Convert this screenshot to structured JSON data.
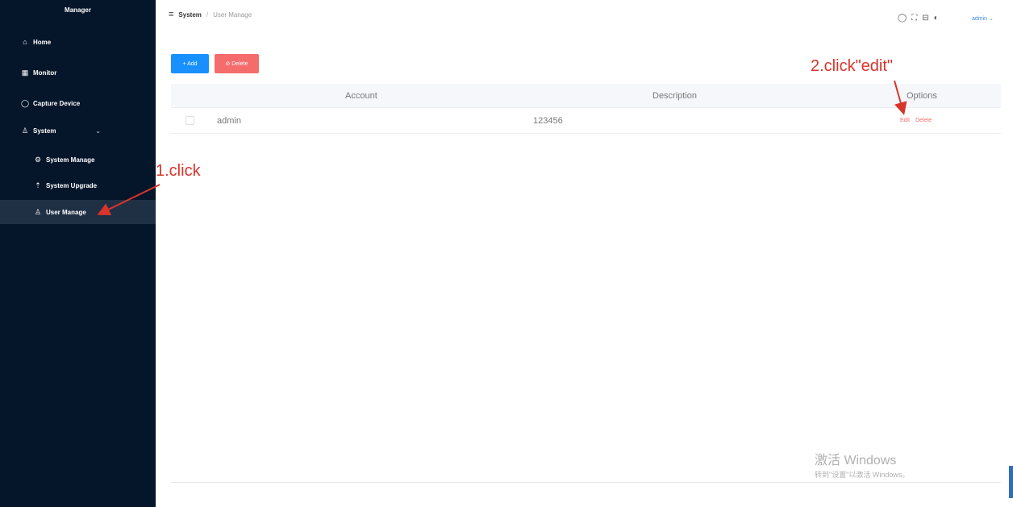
{
  "sidebar": {
    "logo": "Manager",
    "items": [
      {
        "label": "Home",
        "icon": "home-icon",
        "glyph": "⌂"
      },
      {
        "label": "Monitor",
        "icon": "monitor-icon",
        "glyph": "▦"
      },
      {
        "label": "Capture Device",
        "icon": "camera-icon",
        "glyph": "◯"
      },
      {
        "label": "System",
        "icon": "user-icon",
        "glyph": "♙"
      }
    ],
    "sub_items": [
      {
        "label": "System Manage",
        "icon": "gear-icon",
        "glyph": "⚙"
      },
      {
        "label": "System Upgrade",
        "icon": "upload-icon",
        "glyph": "⇡"
      },
      {
        "label": "User Manage",
        "icon": "user-icon",
        "glyph": "♙"
      }
    ],
    "system_chevron": "⌄"
  },
  "header": {
    "menu_icon": "≡",
    "breadcrumb": [
      "System",
      "User Manage"
    ],
    "separator": "/",
    "user": "admin ⌄"
  },
  "toolbar": {
    "add_label": "+ Add",
    "delete_label": "⊘ Delete"
  },
  "table": {
    "headers": [
      "Account",
      "Description",
      "Options"
    ],
    "rows": [
      {
        "account": "admin",
        "description": "123456",
        "edit": "Edit",
        "delete": "Delete"
      }
    ]
  },
  "annotations": {
    "step1": "1.click",
    "step2": "2.click\"edit\""
  },
  "watermark": {
    "line1": "激活 Windows",
    "line2": "转到\"设置\"以激活 Windows。"
  },
  "colors": {
    "sidebar_bg": "#06162a",
    "primary": "#1890ff",
    "danger": "#f56c6c",
    "annotation": "#d9342b"
  }
}
